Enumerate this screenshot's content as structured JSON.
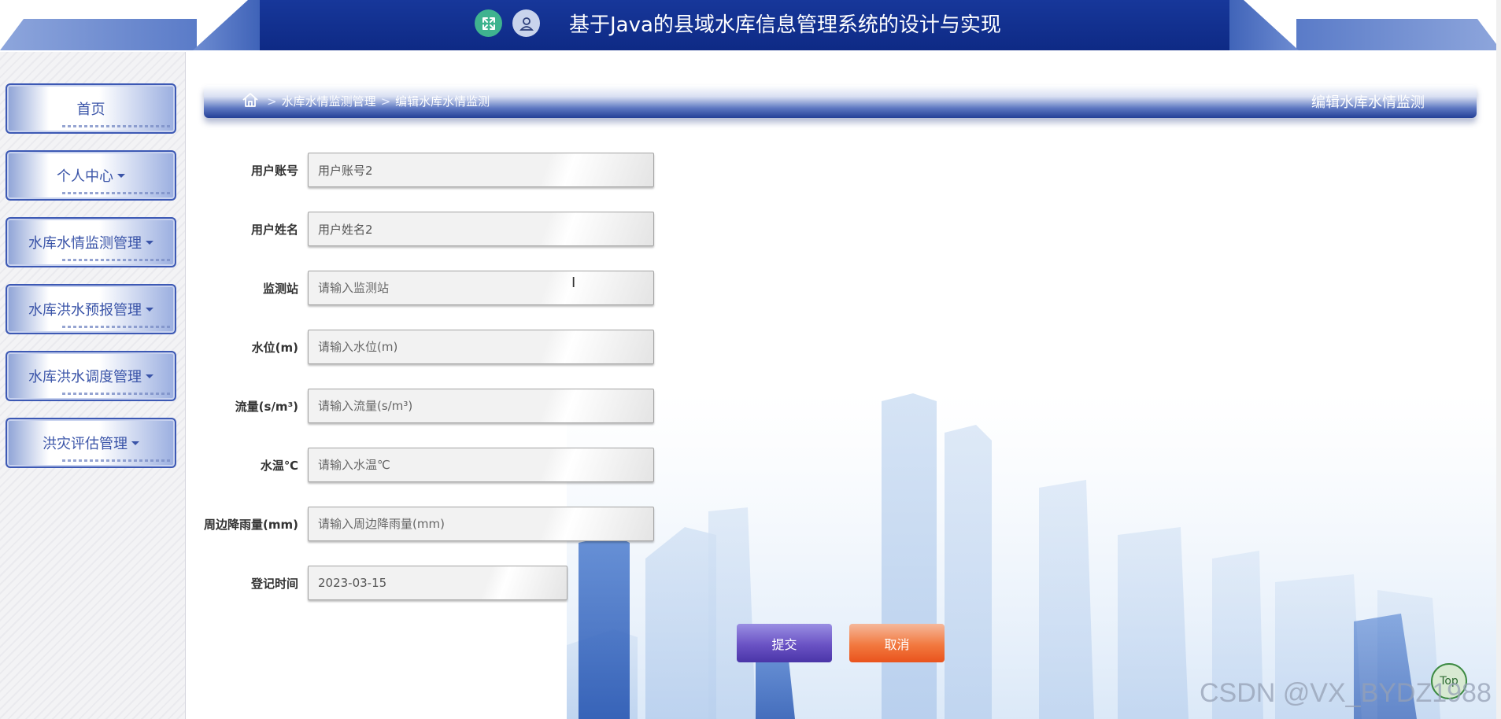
{
  "header": {
    "title": "基于Java的县域水库信息管理系统的设计与实现",
    "expand_icon": "expand-arrows-icon",
    "user_icon": "user-icon"
  },
  "sidebar": {
    "items": [
      {
        "label": "首页",
        "has_caret": false
      },
      {
        "label": "个人中心",
        "has_caret": true
      },
      {
        "label": "水库水情监测管理",
        "has_caret": true
      },
      {
        "label": "水库洪水预报管理",
        "has_caret": true
      },
      {
        "label": "水库洪水调度管理",
        "has_caret": true
      },
      {
        "label": "洪灾评估管理",
        "has_caret": true
      }
    ]
  },
  "breadcrumb": {
    "home_icon": "home-icon",
    "separator": ">",
    "items": [
      "水库水情监测管理",
      "编辑水库水情监测"
    ],
    "page_title": "编辑水库水情监测"
  },
  "form": {
    "fields": [
      {
        "label": "用户账号",
        "value": "用户账号2",
        "placeholder": ""
      },
      {
        "label": "用户姓名",
        "value": "用户姓名2",
        "placeholder": ""
      },
      {
        "label": "监测站",
        "value": "",
        "placeholder": "请输入监测站"
      },
      {
        "label": "水位(m)",
        "value": "",
        "placeholder": "请输入水位(m)"
      },
      {
        "label": "流量(s/m³)",
        "value": "",
        "placeholder": "请输入流量(s/m³)"
      },
      {
        "label": "水温℃",
        "value": "",
        "placeholder": "请输入水温℃"
      },
      {
        "label": "周边降雨量(mm)",
        "value": "",
        "placeholder": "请输入周边降雨量(mm)"
      },
      {
        "label": "登记时间",
        "value": "2023-03-15",
        "placeholder": ""
      }
    ],
    "submit_label": "提交",
    "cancel_label": "取消"
  },
  "top_button_label": "Top",
  "watermark": "CSDN @VX_BYDZ1988",
  "colors": {
    "header_blue": "#0e2a85",
    "menu_border": "#3d59b4",
    "submit": "#6a52c4",
    "cancel": "#f2793f",
    "expand_button": "#3fb38f"
  }
}
